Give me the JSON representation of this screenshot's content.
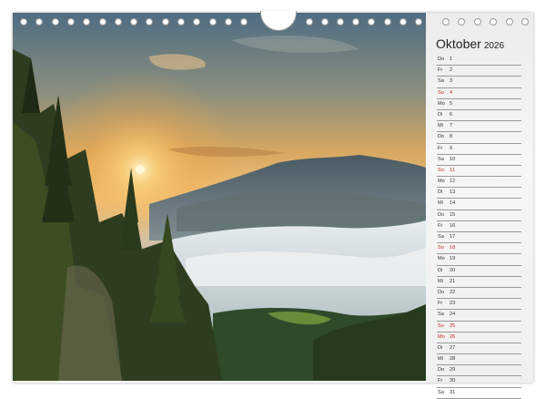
{
  "calendar": {
    "month": "Oktober",
    "year": "2026",
    "days": [
      {
        "weekday": "Do",
        "day": "1",
        "holiday": false
      },
      {
        "weekday": "Fr",
        "day": "2",
        "holiday": false
      },
      {
        "weekday": "Sa",
        "day": "3",
        "holiday": false
      },
      {
        "weekday": "So",
        "day": "4",
        "holiday": true
      },
      {
        "weekday": "Mo",
        "day": "5",
        "holiday": false
      },
      {
        "weekday": "Di",
        "day": "6",
        "holiday": false
      },
      {
        "weekday": "Mi",
        "day": "7",
        "holiday": false
      },
      {
        "weekday": "Do",
        "day": "8",
        "holiday": false
      },
      {
        "weekday": "Fr",
        "day": "9",
        "holiday": false
      },
      {
        "weekday": "Sa",
        "day": "10",
        "holiday": false
      },
      {
        "weekday": "So",
        "day": "11",
        "holiday": true
      },
      {
        "weekday": "Mo",
        "day": "12",
        "holiday": false
      },
      {
        "weekday": "Di",
        "day": "13",
        "holiday": false
      },
      {
        "weekday": "Mi",
        "day": "14",
        "holiday": false
      },
      {
        "weekday": "Do",
        "day": "15",
        "holiday": false
      },
      {
        "weekday": "Fr",
        "day": "16",
        "holiday": false
      },
      {
        "weekday": "Sa",
        "day": "17",
        "holiday": false
      },
      {
        "weekday": "So",
        "day": "18",
        "holiday": true
      },
      {
        "weekday": "Mo",
        "day": "19",
        "holiday": false
      },
      {
        "weekday": "Di",
        "day": "20",
        "holiday": false
      },
      {
        "weekday": "Mi",
        "day": "21",
        "holiday": false
      },
      {
        "weekday": "Do",
        "day": "22",
        "holiday": false
      },
      {
        "weekday": "Fr",
        "day": "23",
        "holiday": false
      },
      {
        "weekday": "Sa",
        "day": "24",
        "holiday": false
      },
      {
        "weekday": "So",
        "day": "25",
        "holiday": true
      },
      {
        "weekday": "Mo",
        "day": "26",
        "holiday": true
      },
      {
        "weekday": "Di",
        "day": "27",
        "holiday": false
      },
      {
        "weekday": "Mi",
        "day": "28",
        "holiday": false
      },
      {
        "weekday": "Do",
        "day": "29",
        "holiday": false
      },
      {
        "weekday": "Fr",
        "day": "30",
        "holiday": false
      },
      {
        "weekday": "Sa",
        "day": "31",
        "holiday": false
      }
    ]
  },
  "colors": {
    "holiday": "#c8232c",
    "sky_top": "#4d6f86",
    "sun_glow": "#f3b24a",
    "forest": "#2f3f1f"
  }
}
